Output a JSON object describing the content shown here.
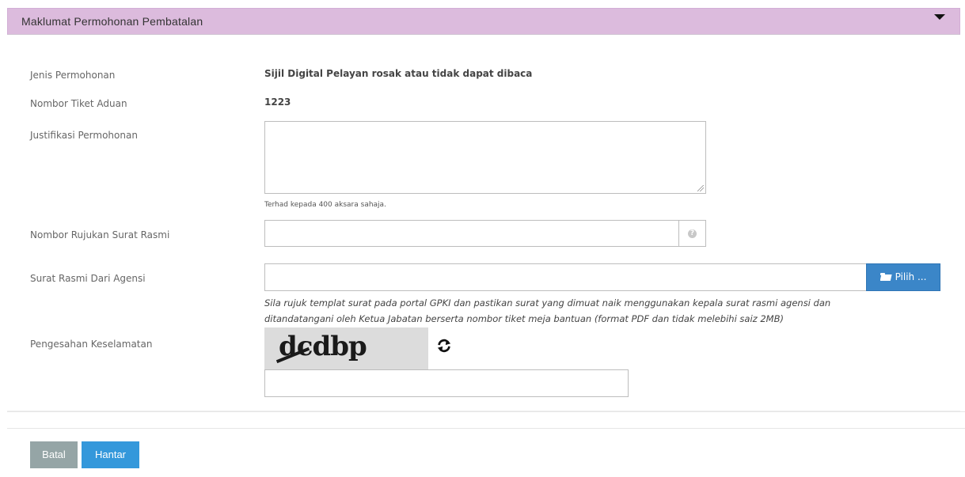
{
  "panel": {
    "title": "Maklumat Permohonan Pembatalan"
  },
  "form": {
    "jenis_label": "Jenis Permohonan",
    "jenis_value": "Sijil Digital Pelayan rosak atau tidak dapat dibaca",
    "tiket_label": "Nombor Tiket Aduan",
    "tiket_value": "1223",
    "justifikasi_label": "Justifikasi Permohonan",
    "justifikasi_value": "",
    "justifikasi_hint": "Terhad kepada 400 aksara sahaja.",
    "rujukan_label": "Nombor Rujukan Surat Rasmi",
    "rujukan_value": "",
    "surat_label": "Surat Rasmi Dari Agensi",
    "surat_value": "",
    "pilih_label": "Pilih ...",
    "surat_hint_1": "Sila rujuk templat surat pada portal GPKI dan pastikan surat yang dimuat naik menggunakan kepala surat rasmi agensi dan",
    "surat_hint_2": "ditandatangani oleh Ketua Jabatan berserta nombor tiket meja bantuan (format PDF dan tidak melebihi saiz 2MB)",
    "captcha_label": "Pengesahan Keselamatan",
    "captcha_text": "dcdbp",
    "captcha_value": ""
  },
  "actions": {
    "batal": "Batal",
    "hantar": "Hantar"
  },
  "icons": {
    "collapse": "caret-down-icon",
    "help": "question-circle-icon",
    "folder": "folder-open-icon",
    "refresh": "refresh-icon"
  },
  "colors": {
    "header_bg": "#dcbbdd",
    "primary": "#3498db",
    "secondary": "#95a5a6"
  }
}
